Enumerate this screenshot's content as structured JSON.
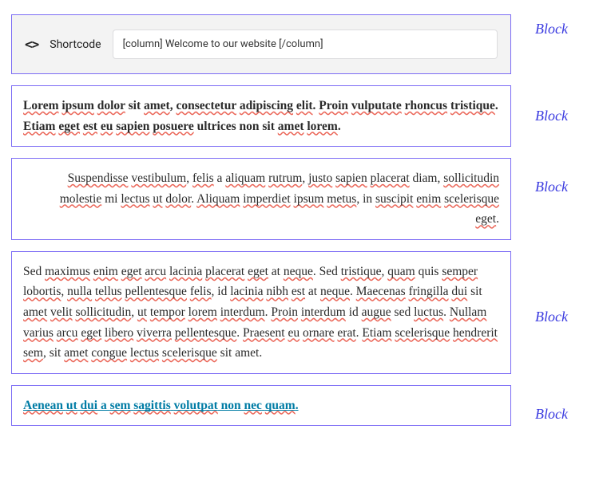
{
  "shortcode": {
    "icon_glyph": "<>",
    "title": "Shortcode",
    "value": "[column] Welcome to our website [/column]"
  },
  "blocks": {
    "label": "Block"
  },
  "paragraphs": {
    "p1": {
      "words": [
        "Lorem",
        " ",
        "ipsum",
        " ",
        "dolor",
        " sit ",
        "amet",
        ", ",
        "consectetur",
        " ",
        "adipiscing",
        " ",
        "elit",
        ". ",
        "Proin",
        " ",
        "vulputate",
        " ",
        "rhoncus",
        " ",
        "tristique",
        ". ",
        "Etiam",
        " ",
        "eget",
        " ",
        "est",
        " ",
        "eu",
        " ",
        "sapien",
        " ",
        "posuere",
        " ",
        "ultrices",
        " non sit ",
        "amet",
        " ",
        "lorem",
        "."
      ],
      "spelled": [
        0,
        2,
        4,
        6,
        8,
        10,
        12,
        14,
        16,
        18,
        20,
        22,
        24,
        26,
        28,
        30,
        32,
        36,
        38
      ]
    },
    "p2": {
      "words": [
        "Suspendisse",
        " ",
        "vestibulum",
        ", ",
        "felis",
        " a ",
        "aliquam",
        " ",
        "rutrum",
        ", ",
        "justo",
        " ",
        "sapien",
        " ",
        "placerat",
        " diam, ",
        "sollicitudin",
        " ",
        "molestie",
        " mi ",
        "lectus",
        " ",
        "ut",
        " ",
        "dolor",
        ". ",
        "Aliquam",
        " ",
        "imperdiet",
        " ",
        "ipsum",
        " ",
        "metus",
        ", in ",
        "suscipit",
        " ",
        "enim",
        " ",
        "scelerisque",
        " ",
        "eget",
        "."
      ],
      "spelled": [
        0,
        2,
        4,
        6,
        8,
        10,
        12,
        14,
        16,
        18,
        20,
        22,
        24,
        26,
        28,
        30,
        32,
        34,
        36,
        38,
        40
      ]
    },
    "p3": {
      "words": [
        "Sed ",
        "maximus",
        " ",
        "enim",
        " ",
        "eget",
        " ",
        "arcu",
        " ",
        "lacinia",
        " ",
        "placerat",
        " ",
        "eget",
        " at ",
        "neque",
        ". Sed ",
        "tristique",
        ", ",
        "quam",
        " quis ",
        "semper",
        " ",
        "lobortis",
        ", ",
        "nulla",
        " ",
        "tellus",
        " ",
        "pellentesque",
        " ",
        "felis",
        ", id ",
        "lacinia",
        " ",
        "nibh",
        " ",
        "est",
        " at ",
        "neque",
        ". ",
        "Maecenas",
        " ",
        "fringilla",
        " ",
        "dui",
        " sit ",
        "amet",
        " ",
        "velit",
        " ",
        "sollicitudin",
        ", ",
        "ut",
        " ",
        "tempor",
        " ",
        "lorem",
        " ",
        "interdum",
        ". ",
        "Proin",
        " ",
        "interdum",
        " id ",
        "augue",
        " sed ",
        "luctus",
        ". ",
        "Nullam",
        " ",
        "varius",
        " ",
        "arcu",
        " ",
        "eget",
        " ",
        "libero",
        " ",
        "viverra",
        " ",
        "pellentesque",
        ". ",
        "Praesent",
        " ",
        "eu",
        " ",
        "ornare",
        " ",
        "erat",
        ". ",
        "Etiam",
        " ",
        "scelerisque",
        " ",
        "hendrerit",
        " ",
        "sem",
        ", sit ",
        "amet",
        " ",
        "congue",
        " ",
        "lectus",
        " ",
        "scelerisque",
        " sit ",
        "amet",
        "."
      ],
      "spelled": [
        1,
        3,
        5,
        7,
        9,
        11,
        13,
        15,
        17,
        19,
        21,
        23,
        25,
        27,
        29,
        31,
        33,
        35,
        37,
        39,
        41,
        43,
        45,
        47,
        49,
        51,
        53,
        55,
        57,
        59,
        61,
        63,
        65,
        67,
        69,
        71,
        73,
        75,
        77,
        79,
        81,
        83,
        85,
        87,
        89,
        91,
        93,
        95,
        97,
        99,
        101,
        103,
        105
      ]
    },
    "p4": {
      "words": [
        "Aenean",
        " ",
        "ut",
        " ",
        "dui",
        " a ",
        "sem",
        " ",
        "sagittis",
        " ",
        "volutpat",
        " non ",
        "nec",
        " ",
        "quam",
        "."
      ],
      "spelled": [
        0,
        2,
        4,
        6,
        8,
        10,
        12,
        14
      ]
    }
  }
}
